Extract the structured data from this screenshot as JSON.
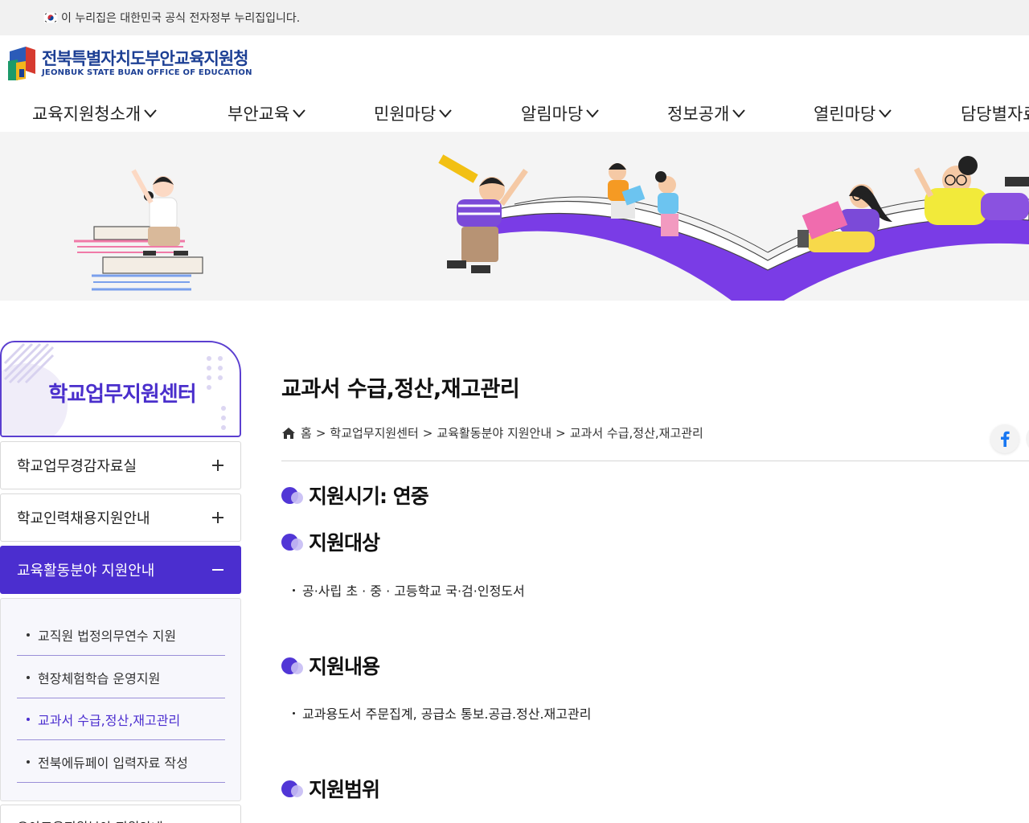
{
  "gov_banner": {
    "text": "이 누리집은 대한민국 공식 전자정부 누리집입니다."
  },
  "logo": {
    "name_ko": "전북특별자치도부안교육지원청",
    "name_en": "JEONBUK STATE BUAN OFFICE OF EDUCATION"
  },
  "gnb": [
    {
      "label": "교육지원청소개"
    },
    {
      "label": "부안교육"
    },
    {
      "label": "민원마당"
    },
    {
      "label": "알림마당"
    },
    {
      "label": "정보공개"
    },
    {
      "label": "열린마당"
    },
    {
      "label": "담당별자료"
    }
  ],
  "sidebar": {
    "title": "학교업무지원센터",
    "items": [
      {
        "label": "학교업무경감자료실",
        "toggle": "+"
      },
      {
        "label": "학교인력채용지원안내",
        "toggle": "+"
      },
      {
        "label": "교육활동분야 지원안내",
        "toggle": "−"
      }
    ],
    "sub_items": [
      {
        "label": "교직원 법정의무연수 지원"
      },
      {
        "label": "현장체험학습 운영지원"
      },
      {
        "label": "교과서 수급,정산,재고관리"
      },
      {
        "label": "전북에듀페이 입력자료 작성"
      }
    ],
    "next_item": {
      "label": "유아교육지원분야 지원안내"
    }
  },
  "content": {
    "title": "교과서 수급,정산,재고관리",
    "breadcrumb": [
      "홈",
      "학교업무지원센터",
      "교육활동분야 지원안내",
      "교과서 수급,정산,재고관리"
    ],
    "breadcrumb_sep": ">",
    "sections": [
      {
        "title": "지원시기: 연중"
      },
      {
        "title": "지원대상",
        "text": "공·사립 초 · 중 · 고등학교 국·검·인정도서"
      },
      {
        "title": "지원내용",
        "text": "교과용도서 주문집계, 공급소 통보.공급.정산.재고관리"
      },
      {
        "title": "지원범위"
      }
    ]
  },
  "colors": {
    "accent": "#4b2ecf",
    "logo": "#1c3f94",
    "facebook": "#1877f2"
  }
}
